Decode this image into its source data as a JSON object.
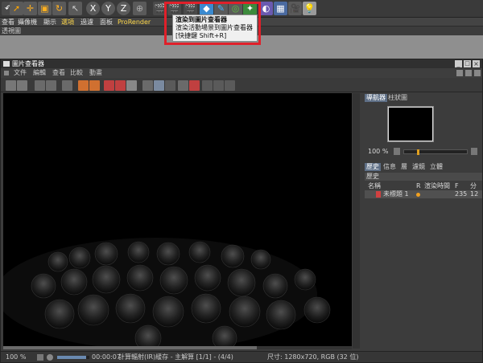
{
  "menubar": {
    "items": [
      "查看",
      "攝像機",
      "顯示",
      "選項",
      "過濾",
      "面板",
      "ProRender"
    ]
  },
  "subbar": {
    "label": "透視圖"
  },
  "tooltip": {
    "title": "渲染到圖片查看器",
    "description": "渲染活動場景到圖片查看器",
    "shortcut": "[快捷鍵 Shift+R]"
  },
  "picture_viewer": {
    "title": "圖片查看器",
    "menu": [
      "文件",
      "編輯",
      "查看",
      "比較",
      "動畫"
    ],
    "navigator_tabs": [
      "導航器",
      "柱狀圖"
    ],
    "zoom": "100 %",
    "info_tabs": [
      "歷史",
      "信息",
      "層",
      "濾鏡",
      "立體"
    ],
    "history_header": "歷史",
    "table": {
      "columns": [
        "名稱",
        "R",
        "渲染時間",
        "F",
        "分"
      ],
      "rows": [
        {
          "name": "未標題 1",
          "time": "235",
          "extra": "12"
        }
      ]
    },
    "status": {
      "zoom": "100 %",
      "time": "00:00:07",
      "progress_text": "計算輻射(IR)緩存 - 主解算 [1/1] - (4/4)",
      "size": "尺寸: 1280x720, RGB (32 位)"
    }
  },
  "colors": {
    "accent_red": "#e0202a",
    "tab_active": "#5e6f86",
    "render_bg": "#000000"
  }
}
